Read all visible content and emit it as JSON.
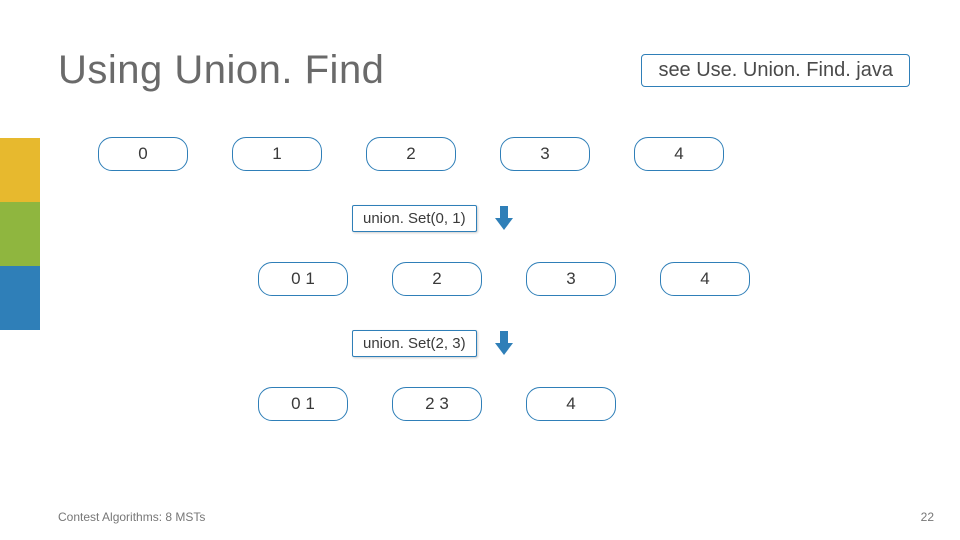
{
  "title": "Using Union. Find",
  "see_reference": "see Use. Union. Find. java",
  "rows": {
    "initial": [
      "0",
      "1",
      "2",
      "3",
      "4"
    ],
    "after_first": [
      "0  1",
      "2",
      "3",
      "4"
    ],
    "after_second": [
      "0  1",
      "2  3",
      "4"
    ]
  },
  "operations": {
    "first": "union. Set(0, 1)",
    "second": "union. Set(2, 3)"
  },
  "footer": {
    "left": "Contest Algorithms: 8 MSTs",
    "page": "22"
  },
  "colors": {
    "border": "#2f7fb8",
    "accent_yellow": "#e7b92e",
    "accent_green": "#8fb63f",
    "accent_blue": "#2f7fb8"
  }
}
